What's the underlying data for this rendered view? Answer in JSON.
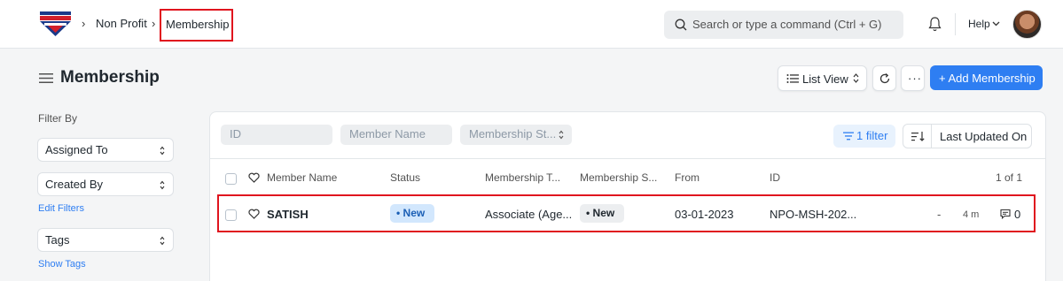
{
  "navbar": {
    "breadcrumbs": [
      "Non Profit",
      "Membership"
    ],
    "search_placeholder": "Search or type a command (Ctrl + G)",
    "help_label": "Help"
  },
  "page": {
    "title": "Membership",
    "list_view_label": "List View",
    "more_label": "···",
    "add_button_label": "+ Add Membership"
  },
  "sidebar": {
    "filter_by_label": "Filter By",
    "assigned_to_label": "Assigned To",
    "created_by_label": "Created By",
    "edit_filters_label": "Edit Filters",
    "tags_label": "Tags",
    "show_tags_label": "Show Tags"
  },
  "filters": {
    "id_placeholder": "ID",
    "member_name_placeholder": "Member Name",
    "membership_status_placeholder": "Membership St...",
    "filter_button_label": "1 filter",
    "sort_label": "Last Updated On"
  },
  "table": {
    "columns": [
      "Member Name",
      "Status",
      "Membership T...",
      "Membership S...",
      "From",
      "ID"
    ],
    "count_label": "1 of 1",
    "rows": [
      {
        "member_name": "SATISH",
        "status": "New",
        "membership_type": "Associate (Age...",
        "membership_status": "New",
        "from": "03-01-2023",
        "id": "NPO-MSH-202...",
        "dash": "-",
        "modified": "4 m",
        "comments": "0"
      }
    ]
  },
  "colors": {
    "primary": "#2e7ef2",
    "highlight_border": "#e0141e",
    "status_blue_bg": "#d2e7fd"
  },
  "icons": [
    "app-logo-icon",
    "search-icon",
    "bell-icon",
    "chevron-down-icon",
    "hamburger-icon",
    "list-icon",
    "refresh-icon",
    "filter-icon",
    "sort-icon",
    "heart-icon",
    "comment-icon"
  ]
}
